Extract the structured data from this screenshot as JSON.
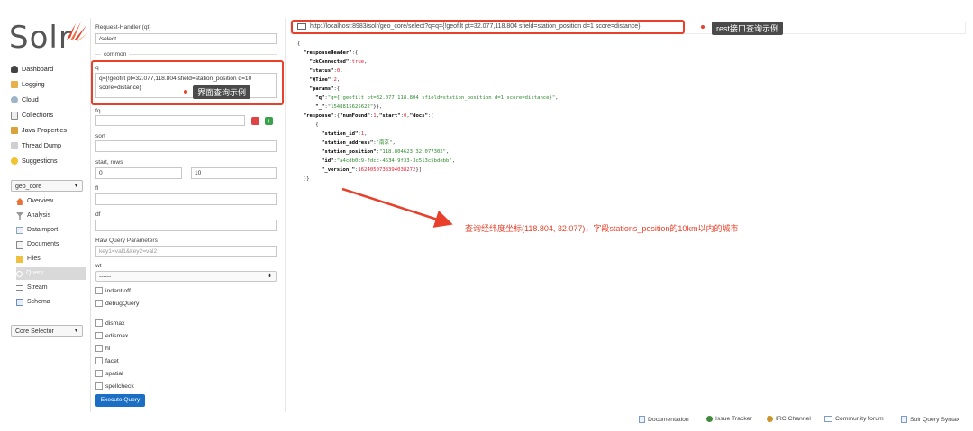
{
  "logo": {
    "text": "Solr"
  },
  "sidebar": {
    "items": [
      {
        "label": "Dashboard",
        "icon": "dashboard-icon"
      },
      {
        "label": "Logging",
        "icon": "logging-icon"
      },
      {
        "label": "Cloud",
        "icon": "cloud-icon"
      },
      {
        "label": "Collections",
        "icon": "collections-icon"
      },
      {
        "label": "Java Properties",
        "icon": "java-properties-icon"
      },
      {
        "label": "Thread Dump",
        "icon": "thread-dump-icon"
      },
      {
        "label": "Suggestions",
        "icon": "suggestions-icon"
      }
    ],
    "core_select": "geo_core",
    "core_items": [
      {
        "label": "Overview",
        "icon": "overview-icon"
      },
      {
        "label": "Analysis",
        "icon": "analysis-icon"
      },
      {
        "label": "Dataimport",
        "icon": "dataimport-icon"
      },
      {
        "label": "Documents",
        "icon": "documents-icon"
      },
      {
        "label": "Files",
        "icon": "files-icon"
      },
      {
        "label": "Query",
        "icon": "query-icon"
      },
      {
        "label": "Stream",
        "icon": "stream-icon"
      },
      {
        "label": "Schema",
        "icon": "schema-icon"
      }
    ],
    "core_selector": "Core Selector"
  },
  "form": {
    "request_handler_label": "Request-Handler (qt)",
    "request_handler_value": "/select",
    "common_legend": "common",
    "q_label": "q",
    "q_value": "q={!geofilt pt=32.077,118.804 sfield=station_position d=10 score=distance}",
    "q_annotation": "界面查询示例",
    "fq_label": "fq",
    "sort_label": "sort",
    "start_rows_label": "start, rows",
    "start_value": "0",
    "rows_value": "10",
    "fl_label": "fl",
    "df_label": "df",
    "raw_label": "Raw Query Parameters",
    "raw_placeholder": "key1=val1&key2=val2",
    "wt_label": "wt",
    "wt_value": "------",
    "indent_off": "indent off",
    "debug_query": "debugQuery",
    "dismax": "dismax",
    "edismax": "edismax",
    "hl": "hl",
    "facet": "facet",
    "spatial": "spatial",
    "spellcheck": "spellcheck",
    "execute": "Execute Query"
  },
  "url_bar": {
    "url": "http://localhost:8983/solr/geo_core/select?q=q={!geofilt pt=32.077,118.804 sfield=station_position d=1 score=distance}",
    "annotation": "rest接口查询示例"
  },
  "result_annotation": "查询经纬度坐标(118.804, 32.077)，字段stations_position的10km以内的城市",
  "json": {
    "l1": "{",
    "rh_key": "\"responseHeader\"",
    "rh_open": ":{",
    "zk_key": "\"zkConnected\"",
    "zk_val": "true",
    "status_key": "\"status\"",
    "status_val": "0",
    "qtime_key": "\"QTime\"",
    "qtime_val": "2",
    "params_key": "\"params\"",
    "params_open": ":{",
    "q_key": "\"q\"",
    "q_val": "\"q={!geofilt pt=32.077,118.804 sfield=station_position d=1 score=distance}\"",
    "us_key": "\"_\"",
    "us_val": "\"1548815625622\"",
    "close_params": "}},",
    "resp_key": "\"response\"",
    "numfound_key": "\"numFound\"",
    "numfound_val": "1",
    "start_key": "\"start\"",
    "start_val": "0",
    "docs_key": "\"docs\"",
    "brace": "{",
    "sid_key": "\"station_id\"",
    "sid_val": "1",
    "saddr_key": "\"station_address\"",
    "saddr_val": "\"南京\"",
    "spos_key": "\"station_position\"",
    "spos_val": "\"118.804623 32.077302\"",
    "id_key": "\"id\"",
    "id_val": "\"a4cdb0c9-fdcc-4534-9f33-3c513c5bdebb\"",
    "ver_key": "\"_version_\"",
    "ver_val": "1624050738394038272",
    "close_docs": "}]",
    "close_all": "}}"
  },
  "footer": [
    {
      "label": "Documentation",
      "icon": "documentation-icon"
    },
    {
      "label": "Issue Tracker",
      "icon": "bug-icon"
    },
    {
      "label": "IRC Channel",
      "icon": "irc-icon"
    },
    {
      "label": "Community forum",
      "icon": "mail-icon"
    },
    {
      "label": "Solr Query Syntax",
      "icon": "syntax-icon"
    }
  ],
  "colors": {
    "accent": "#e8402a",
    "button": "#1a6fc4",
    "logo_flame": "#e8402a"
  }
}
